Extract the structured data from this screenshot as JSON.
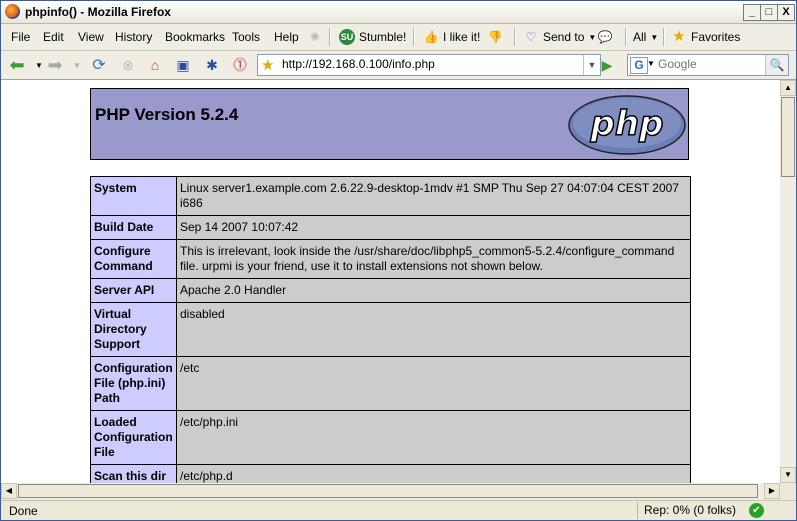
{
  "window": {
    "title": "phpinfo() - Mozilla Firefox",
    "controls": [
      "_",
      "□",
      "X"
    ]
  },
  "menubar": {
    "items": [
      "File",
      "Edit",
      "View",
      "History",
      "Bookmarks",
      "Tools",
      "Help"
    ],
    "stumble": "Stumble!",
    "like": "I like it!",
    "send_to": "Send to",
    "all": "All",
    "favorites": "Favorites"
  },
  "navbar": {
    "url": "http://192.168.0.100/info.php",
    "search_placeholder": "Google"
  },
  "page": {
    "header": "PHP Version 5.2.4",
    "logo_text": "php",
    "rows": [
      {
        "key": "System",
        "value": "Linux server1.example.com 2.6.22.9-desktop-1mdv #1 SMP Thu Sep 27 04:07:04 CEST 2007 i686"
      },
      {
        "key": "Build Date",
        "value": "Sep 14 2007 10:07:42"
      },
      {
        "key": "Configure Command",
        "value": "This is irrelevant, look inside the /usr/share/doc/libphp5_common5-5.2.4/configure_command file. urpmi is your friend, use it to install extensions not shown below."
      },
      {
        "key": "Server API",
        "value": "Apache 2.0 Handler"
      },
      {
        "key": "Virtual Directory Support",
        "value": "disabled"
      },
      {
        "key": "Configuration File (php.ini) Path",
        "value": "/etc"
      },
      {
        "key": "Loaded Configuration File",
        "value": "/etc/php.ini"
      },
      {
        "key": "Scan this dir",
        "value": "/etc/php.d"
      }
    ]
  },
  "status": {
    "text": "Done",
    "rep": "Rep: 0% (0 folks)"
  }
}
